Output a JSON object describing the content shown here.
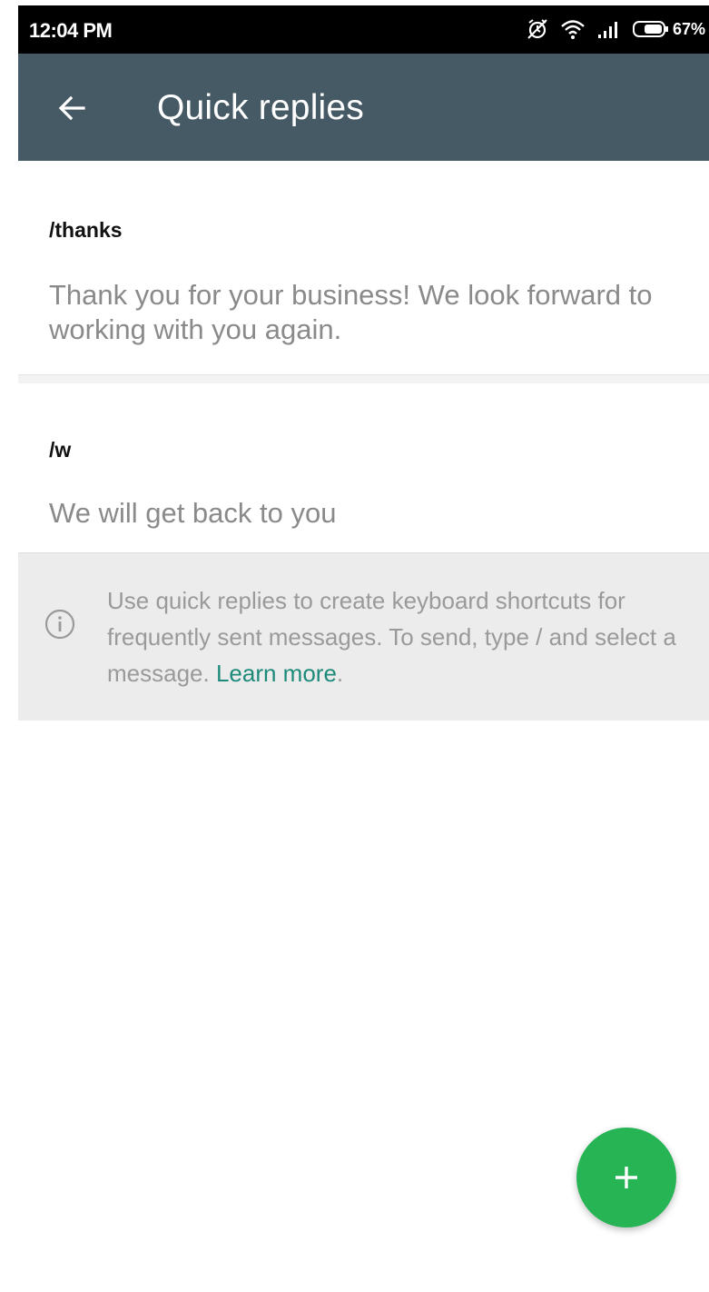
{
  "status_bar": {
    "time": "12:04 PM",
    "battery_percent": "67%",
    "icons": [
      "alarm-icon",
      "wifi-icon",
      "signal-icon",
      "battery-icon"
    ]
  },
  "app_bar": {
    "title": "Quick replies",
    "back_icon": "arrow-left-icon",
    "background_color": "#465a65"
  },
  "replies": [
    {
      "shortcut": "/thanks",
      "message": "Thank you for your business! We look forward to working with you again."
    },
    {
      "shortcut": "/w",
      "message": "We will get back to you"
    }
  ],
  "info_banner": {
    "icon": "info-icon",
    "text": "Use quick replies to create keyboard shortcuts for frequently sent messages. To send, type / and select a message. ",
    "link_text": "Learn more",
    "trailing": "."
  },
  "fab": {
    "icon": "plus-icon",
    "color": "#26b455"
  }
}
